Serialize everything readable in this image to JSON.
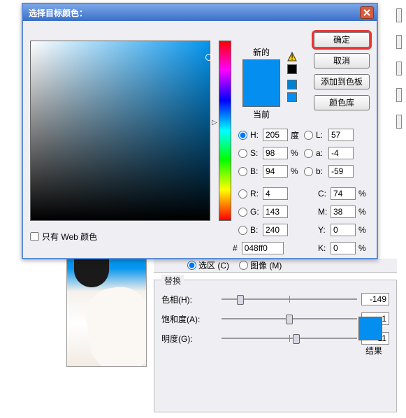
{
  "dialog": {
    "title": "选择目标颜色：",
    "new_label": "新的",
    "current_label": "当前",
    "buttons": {
      "ok": "确定",
      "cancel": "取消",
      "add_swatches": "添加到色板",
      "libraries": "颜色库"
    },
    "hsb": {
      "h": "H:",
      "s": "S:",
      "b": "B:",
      "h_val": "205",
      "s_val": "98",
      "b_val": "94",
      "deg": "度",
      "pct": "%"
    },
    "lab": {
      "l": "L:",
      "a": "a:",
      "b": "b:",
      "l_val": "57",
      "a_val": "-4",
      "b_val": "-59"
    },
    "rgb": {
      "r": "R:",
      "g": "G:",
      "b": "B:",
      "r_val": "4",
      "g_val": "143",
      "b_val": "240"
    },
    "cmyk": {
      "c": "C:",
      "m": "M:",
      "y": "Y:",
      "k": "K:",
      "c_val": "74",
      "m_val": "38",
      "y_val": "0",
      "k_val": "0",
      "pct": "%"
    },
    "hex_label": "#",
    "hex_val": "048ff0",
    "web_only": "只有 Web 颜色"
  },
  "lower": {
    "selection": "选区 (C)",
    "image": "图像 (M)",
    "group": "替换",
    "hue": "色相(H):",
    "sat": "饱和度(A):",
    "light": "明度(G):",
    "hue_val": "-149",
    "sat_val": "-1",
    "light_val": "+11",
    "result": "结果"
  },
  "colors": {
    "swatch": "#048ff0"
  }
}
